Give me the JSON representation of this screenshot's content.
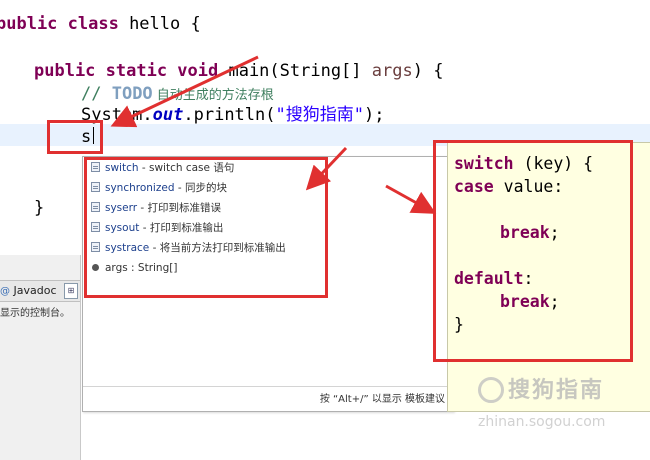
{
  "editor": {
    "lines": {
      "class_kw": "public class",
      "class_rest": " hello {",
      "main_kw": "public static void",
      "main_sig_a": " main(String[] ",
      "main_param": "args",
      "main_sig_b": ") {",
      "todo_prefix": "// ",
      "todo_tag": "TODO",
      "todo_text": " 自动生成的方法存根",
      "sysout_a": "System.",
      "sysout_out": "out",
      "sysout_b": ".println(",
      "sysout_str": "\"搜狗指南\"",
      "sysout_c": ");",
      "typed": "s",
      "close_brace": "}"
    }
  },
  "left_panel": {
    "tab_label": "Javadoc",
    "console_text": "显示的控制台。"
  },
  "popup": {
    "items": [
      {
        "name": "switch",
        "desc": "  -  switch case 语句"
      },
      {
        "name": "synchronized",
        "desc": "  -  同步的块"
      },
      {
        "name": "syserr",
        "desc": "  -  打印到标准错误"
      },
      {
        "name": "sysout",
        "desc": "  -  打印到标准输出"
      },
      {
        "name": "systrace",
        "desc": "  -  将当前方法打印到标准输出"
      },
      {
        "name": "args : String[]",
        "desc": ""
      }
    ],
    "footer": "按 “Alt+/” 以显示 模板建议"
  },
  "preview": {
    "l1_kw": "switch",
    "l1_rest": " (key) {",
    "l2_kw": "case",
    "l2_rest": " value:",
    "l3_kw": "break",
    "l3_rest": ";",
    "l4_kw": "default",
    "l4_rest": ":",
    "l5_kw": "break",
    "l5_rest": ";",
    "l6": "}"
  },
  "watermark": {
    "text": "搜狗指南",
    "url": "zhinan.sogou.com"
  },
  "colors": {
    "annotation_red": "#e03030",
    "keyword": "#7f0055",
    "preview_bg": "#ffffe1"
  }
}
